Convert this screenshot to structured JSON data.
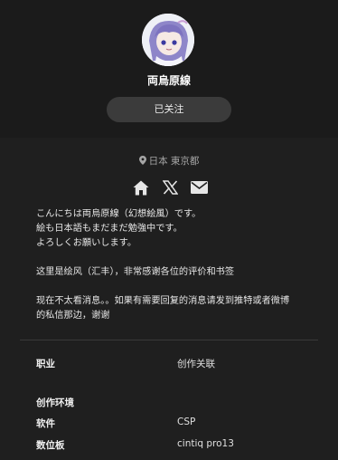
{
  "profile": {
    "name": "両烏原線",
    "follow_label": "已关注",
    "location": "日本 東京都"
  },
  "links": [
    {
      "icon": "home-icon"
    },
    {
      "icon": "x-icon"
    },
    {
      "icon": "mail-icon"
    }
  ],
  "bio": {
    "lines": [
      "こんにちは両烏原線（幻想絵風）です。",
      "絵も日本語もまだまだ勉強中です。",
      "よろしくお願いします。",
      "",
      "这里是绘风（汇丰），非常感谢各位的评价和书签",
      "",
      "现在不太看消息。。如果有需要回复的消息请发到推特或者微博",
      "的私信那边，谢谢"
    ]
  },
  "details": {
    "job_label": "职业",
    "job_value": "创作关联",
    "env_title": "创作环境",
    "software_label": "软件",
    "software_value": "CSP",
    "tablet_label": "数位板",
    "tablet_value": "cintiq pro13"
  },
  "colors": {
    "background": "#1f1f1f",
    "header_background": "#1b1b1b",
    "button_background": "#3b3b3b",
    "muted_text": "#a6a6a6"
  }
}
